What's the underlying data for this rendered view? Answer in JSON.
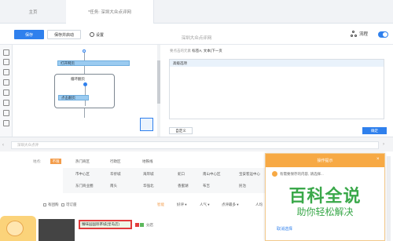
{
  "tabs": [
    {
      "label": "主页"
    },
    {
      "label": "*任务: 深圳大众点评网"
    }
  ],
  "toolbar": {
    "save_label": "保存",
    "save_start_label": "保存并启动",
    "settings_label": "设置",
    "doc_title": "深圳大众点评网",
    "flow_label": "流程"
  },
  "designer": {
    "node_open": "打开网页",
    "loop_title": "循环翻页",
    "node_next": "点击翻页"
  },
  "properties": {
    "header_prefix": "要点击的元素",
    "header_value": "标签A, 文本(下一页",
    "row_label": "高级选项",
    "custom_label": "自定义",
    "ok_label": "确定"
  },
  "browser": {
    "url_placeholder": "深圳大众点评",
    "filter_label": "地点:",
    "filter_hot": "不限",
    "filter_tabs": [
      "热门商区",
      "行政区",
      "地铁线"
    ],
    "area_row1": [
      "市中心区",
      "华侨城",
      "海岸城",
      "蛇口",
      "南山中心区",
      "宝安客运中心"
    ],
    "area_row2": [
      "东门商业圈",
      "南头",
      "华强北",
      "香蜜湖",
      "布吉",
      "民治"
    ],
    "checkbox_1": "有团购",
    "checkbox_2": "可订座",
    "sorts": [
      "智能",
      "好评 ▾",
      "人气 ▾",
      "点评最多 ▾",
      "人均"
    ],
    "listing_title": "臻味园国际茶城(皇岛店)",
    "listing_share": "分店"
  },
  "popup": {
    "title": "操作提示",
    "text": "有需要保存的内容, 请选择...",
    "watermark_title": "百科全说",
    "watermark_sub": "助你轻松解决",
    "cancel_label": "取消选择"
  },
  "colors": {
    "accent": "#2f80ed",
    "popup_orange": "#f7a944",
    "highlight_red": "#e23c3c",
    "watermark_green": "#3aa84a"
  }
}
